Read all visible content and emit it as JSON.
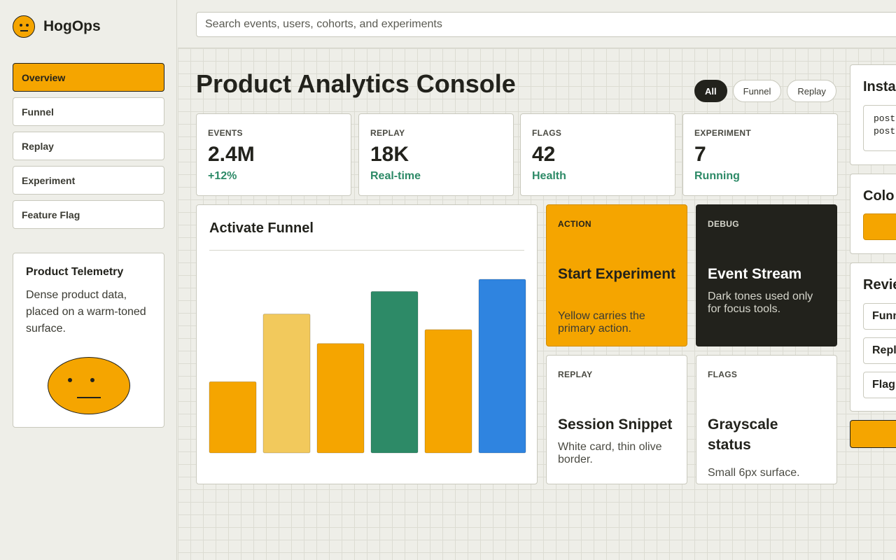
{
  "app": {
    "name": "HogOps"
  },
  "sidebar": {
    "items": [
      {
        "label": "Overview",
        "active": true
      },
      {
        "label": "Funnel"
      },
      {
        "label": "Replay"
      },
      {
        "label": "Experiment"
      },
      {
        "label": "Feature Flag"
      }
    ],
    "card": {
      "title": "Product Telemetry",
      "body": "Dense product data, placed on a warm-toned surface."
    }
  },
  "search": {
    "placeholder": "Search events, users, cohorts, and experiments",
    "value": ""
  },
  "page": {
    "title": "Product Analytics Console"
  },
  "filters": [
    {
      "label": "All",
      "active": true
    },
    {
      "label": "Funnel"
    },
    {
      "label": "Replay"
    }
  ],
  "stats": [
    {
      "label": "EVENTS",
      "value": "2.4M",
      "delta": "+12%"
    },
    {
      "label": "REPLAY",
      "value": "18K",
      "delta": "Real-time"
    },
    {
      "label": "FLAGS",
      "value": "42",
      "delta": "Health"
    },
    {
      "label": "EXPERIMENT",
      "value": "7",
      "delta": "Running"
    }
  ],
  "funnel": {
    "title": "Activate Funnel"
  },
  "chart_data": {
    "type": "bar",
    "title": "Activate Funnel",
    "categories": [
      "",
      "",
      "",
      "",
      "",
      ""
    ],
    "values": [
      41,
      80,
      63,
      93,
      71,
      100
    ],
    "colors": [
      "#f5a500",
      "#f2c95c",
      "#f5a500",
      "#2d8a67",
      "#f5a500",
      "#2f84e0"
    ],
    "ylim": [
      0,
      100
    ],
    "grid": false
  },
  "cards": [
    {
      "kicker": "ACTION",
      "title": "Start Experiment",
      "desc": "Yellow carries the primary action.",
      "theme": "yellow"
    },
    {
      "kicker": "DEBUG",
      "title": "Event Stream",
      "desc": "Dark tones used only for focus tools.",
      "theme": "dark"
    },
    {
      "kicker": "REPLAY",
      "title": "Session Snippet",
      "desc": "White card, thin olive border.",
      "theme": "light"
    },
    {
      "kicker": "FLAGS",
      "title": "Grayscale status",
      "desc": "Small 6px surface.",
      "theme": "light"
    }
  ],
  "right_panels": {
    "install": {
      "title": "Insta",
      "code": "post\npost"
    },
    "colors": {
      "title": "Colo"
    },
    "review": {
      "title": "Revie",
      "items": [
        "Funn",
        "Repl",
        "Flag"
      ]
    }
  },
  "colors": {
    "accent": "#f5a500",
    "dark": "#22221c",
    "positive": "#2d8a67",
    "blue": "#2f84e0",
    "light_yellow": "#f2c95c",
    "background": "#eeeee8"
  }
}
